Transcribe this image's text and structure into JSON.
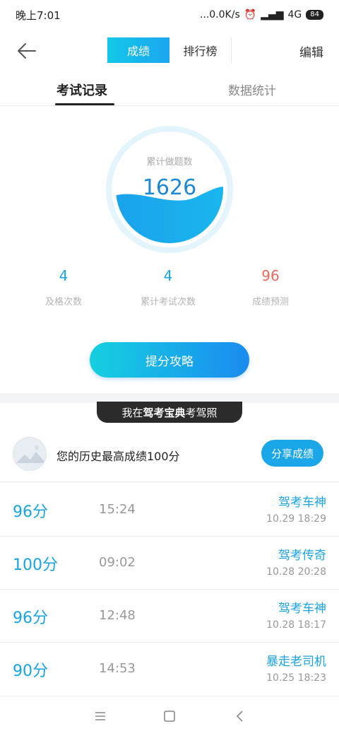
{
  "status_bar": {
    "time": "晚上7:01",
    "network_speed": "...0.0K/s",
    "network_type": "4G",
    "battery": "84"
  },
  "header": {
    "back_icon": "arrow-left-icon",
    "tabs": [
      "成绩",
      "排行榜"
    ],
    "active_tab": "成绩",
    "edit_label": "编辑"
  },
  "subtabs": {
    "items": [
      "考试记录",
      "数据统计"
    ],
    "active": "考试记录"
  },
  "summary": {
    "label": "累计做题数",
    "value": "1626",
    "fill_fraction": 0.45,
    "stats": [
      {
        "value": "4",
        "label": "及格次数"
      },
      {
        "value": "4",
        "label": "累计考试次数"
      },
      {
        "value": "96",
        "label": "成绩预测"
      }
    ],
    "strategy_button": "提分攻略"
  },
  "banner": {
    "prefix": "我在",
    "brand": "驾考宝典",
    "suffix": "考驾照"
  },
  "best": {
    "text": "您的历史最高成绩100分",
    "share_button": "分享成绩"
  },
  "records": [
    {
      "score": "96分",
      "duration": "15:24",
      "title": "驾考车神",
      "date": "10.29  18:29"
    },
    {
      "score": "100分",
      "duration": "09:02",
      "title": "驾考传奇",
      "date": "10.28  20:28"
    },
    {
      "score": "96分",
      "duration": "12:48",
      "title": "驾考车神",
      "date": "10.28  18:17"
    },
    {
      "score": "90分",
      "duration": "14:53",
      "title": "暴走老司机",
      "date": "10.25  18:23"
    }
  ],
  "colors": {
    "accent": "#1ba3e0",
    "predict": "#e86c5c"
  }
}
